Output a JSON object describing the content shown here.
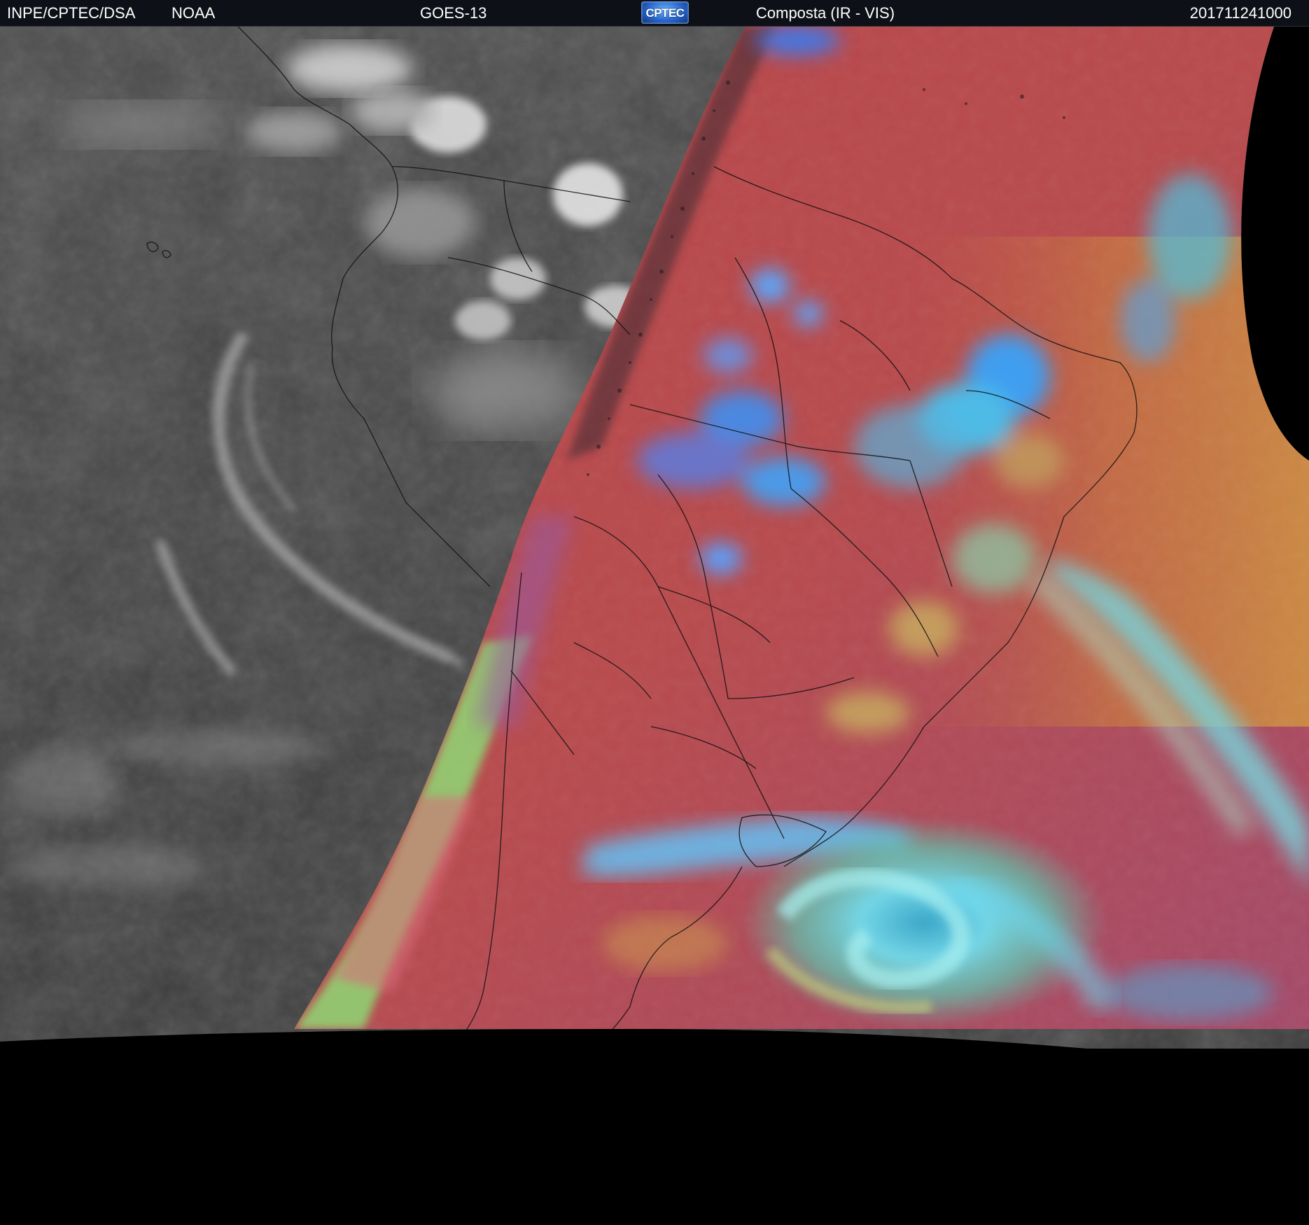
{
  "header": {
    "agency": "INPE/CPTEC/DSA",
    "noaa": "NOAA",
    "satellite": "GOES-13",
    "logo_text": "CPTEC",
    "product": "Composta (IR - VIS)",
    "timestamp": "201711241000"
  },
  "colors": {
    "header_background": "#0d1117",
    "night_ir_gray": "#3e3e3e",
    "day_surface_red": "#b5474a",
    "ocean_orange": "#c9883e",
    "cloud_cyan": "#4cc7e8",
    "cloud_blue": "#3f86e8",
    "terminator_green": "#88d872",
    "space_black": "#000000"
  },
  "regions": [
    "night-side-ir-gray",
    "day-side-composite",
    "space-black"
  ]
}
